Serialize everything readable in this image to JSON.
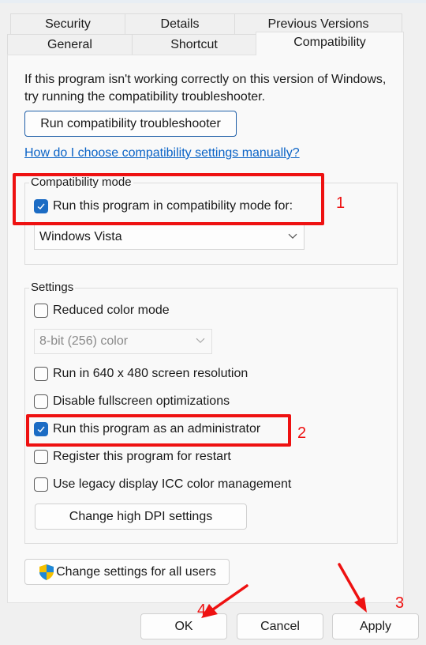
{
  "tabs_row1": [
    {
      "label": "Security"
    },
    {
      "label": "Details"
    },
    {
      "label": "Previous Versions"
    }
  ],
  "tabs_row2": [
    {
      "label": "General"
    },
    {
      "label": "Shortcut"
    },
    {
      "label": "Compatibility",
      "active": true
    }
  ],
  "description": "If this program isn't working correctly on this version of Windows, try running the compatibility troubleshooter.",
  "troubleshooter_button": "Run compatibility troubleshooter",
  "help_link": "How do I choose compatibility settings manually?",
  "compat_mode": {
    "legend": "Compatibility mode",
    "checkbox_label": "Run this program in compatibility mode for:",
    "checked": true,
    "os_selected": "Windows Vista"
  },
  "settings": {
    "legend": "Settings",
    "reduced_color": {
      "label": "Reduced color mode",
      "checked": false
    },
    "color_select": "8-bit (256) color",
    "run_640": {
      "label": "Run in 640 x 480 screen resolution",
      "checked": false
    },
    "disable_fullscreen": {
      "label": "Disable fullscreen optimizations",
      "checked": false
    },
    "run_admin": {
      "label": "Run this program as an administrator",
      "checked": true
    },
    "register_restart": {
      "label": "Register this program for restart",
      "checked": false
    },
    "legacy_icc": {
      "label": "Use legacy display ICC color management",
      "checked": false
    },
    "dpi_button": "Change high DPI settings"
  },
  "all_users_button": "Change settings for all users",
  "footer": {
    "ok": "OK",
    "cancel": "Cancel",
    "apply": "Apply"
  },
  "annotations": [
    "1",
    "2",
    "3",
    "4"
  ],
  "colors": {
    "accent": "#1c6cc4",
    "link": "#0a63c6",
    "annotation": "#ee1111"
  }
}
